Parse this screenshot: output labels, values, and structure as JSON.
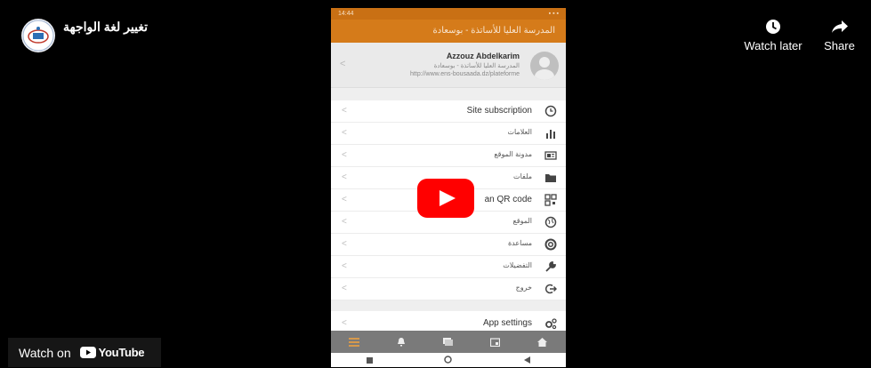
{
  "header": {
    "title": "تغيير لغة الواجهة",
    "channel_logo_icon": "school-logo-icon"
  },
  "actions": {
    "watch_later": "Watch later",
    "share": "Share"
  },
  "phone": {
    "status_time": "14:44",
    "app_title": "المدرسة العليا للأساتذة - بوسعادة",
    "profile": {
      "name": "Azzouz Abdelkarim",
      "org": "المدرسة العليا للأساتذة - بوسعادة",
      "url": "http://www.ens-bousaada.dz/plateforme"
    },
    "menu": [
      {
        "label": "Site subscription",
        "icon": "clock-icon"
      },
      {
        "label": "العلامات",
        "icon": "chart-icon"
      },
      {
        "label": "مدونة الموقع",
        "icon": "blog-icon"
      },
      {
        "label": "ملفات",
        "icon": "folder-icon"
      },
      {
        "label": "an QR code",
        "icon": "qr-code-icon"
      },
      {
        "label": "الموقع",
        "icon": "globe-icon"
      },
      {
        "label": "مساعدة",
        "icon": "help-icon"
      },
      {
        "label": "التفضيلات",
        "icon": "wrench-icon"
      },
      {
        "label": "خروج",
        "icon": "logout-icon"
      }
    ],
    "settings": {
      "label": "App settings",
      "icon": "cogs-icon"
    },
    "bottom_nav": [
      "menu-icon",
      "bell-icon",
      "messages-icon",
      "calendar-icon",
      "home-icon"
    ]
  },
  "watch_on": {
    "label": "Watch on",
    "brand": "YouTube"
  },
  "colors": {
    "app_bar": "#d57b1a",
    "play_red": "#ff0000",
    "nav_gray": "#7a7a7a"
  }
}
